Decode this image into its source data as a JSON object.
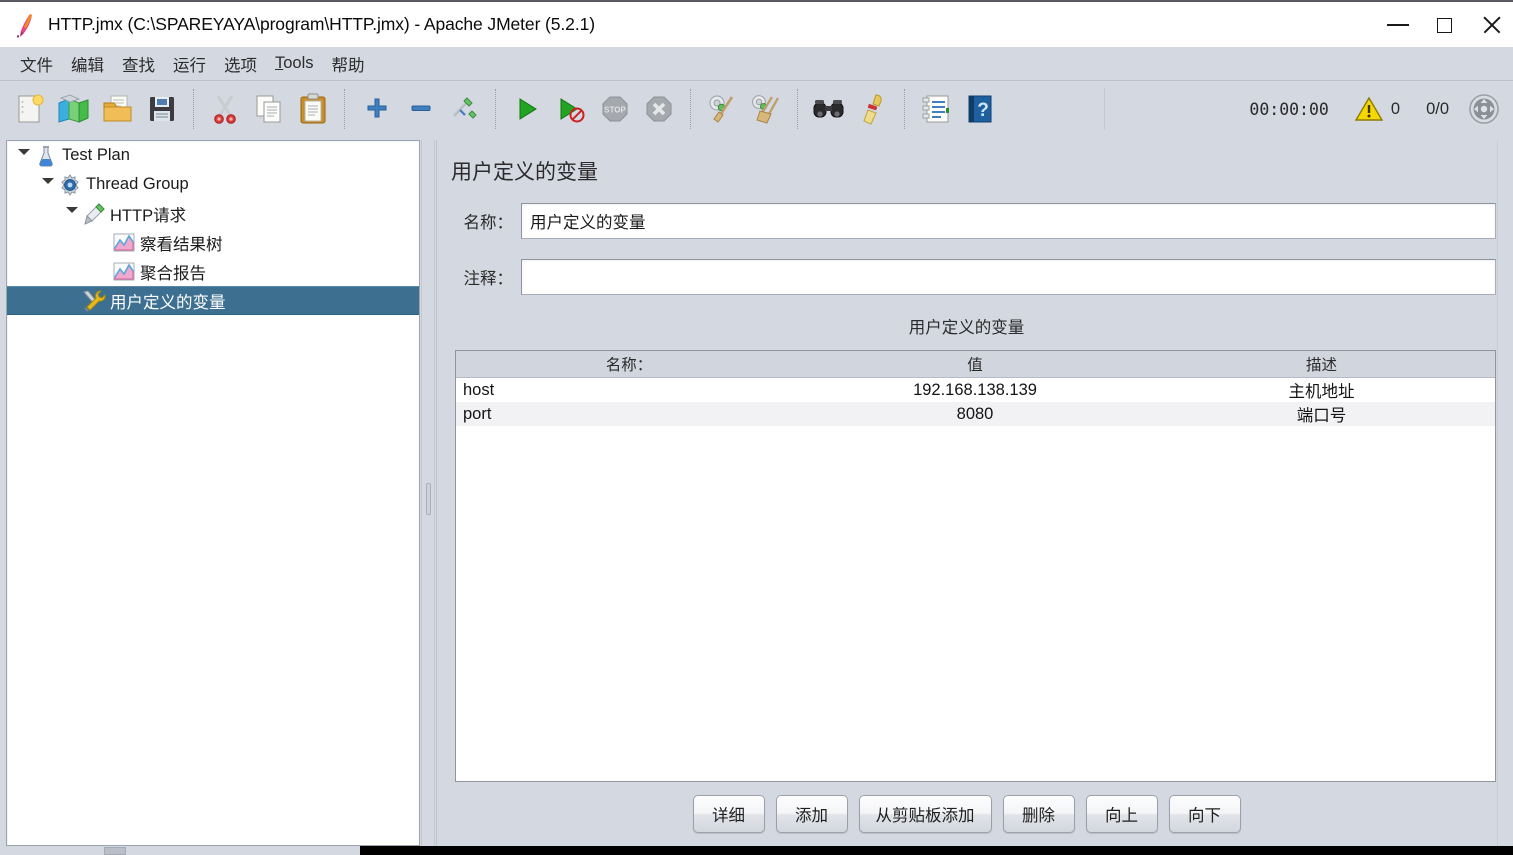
{
  "window": {
    "title": "HTTP.jmx (C:\\SPAREYAYA\\program\\HTTP.jmx) - Apache JMeter (5.2.1)",
    "app_icon": "jmeter-feather-icon",
    "controls": {
      "minimize": "minimize-icon",
      "maximize": "maximize-icon",
      "close": "close-icon"
    }
  },
  "menubar": {
    "items": [
      {
        "label": "文件"
      },
      {
        "label": "编辑"
      },
      {
        "label": "查找"
      },
      {
        "label": "运行"
      },
      {
        "label": "选项"
      },
      {
        "label": "Tools",
        "mnemonic": "T"
      },
      {
        "label": "帮助"
      }
    ]
  },
  "toolbar": {
    "groups": [
      [
        "new-icon",
        "templates-icon",
        "open-icon",
        "save-icon"
      ],
      [
        "cut-icon",
        "copy-icon",
        "paste-icon"
      ],
      [
        "expand-all-icon",
        "collapse-all-icon",
        "toggle-icon"
      ],
      [
        "start-icon",
        "start-no-timers-icon",
        "stop-icon",
        "shutdown-icon"
      ],
      [
        "clear-icon",
        "clear-all-icon"
      ],
      [
        "search-icon",
        "reset-search-icon"
      ],
      [
        "function-helper-icon",
        "help-icon"
      ]
    ],
    "status": {
      "timer": "00:00:00",
      "warning_icon": "warning-triangle-icon",
      "warning_count": "0",
      "thread_count": "0/0",
      "remote_icon": "remote-engines-icon"
    }
  },
  "tree": {
    "items": [
      {
        "label": "Test Plan",
        "icon": "test-plan-icon",
        "indent": 0,
        "expanded": true,
        "selected": false
      },
      {
        "label": "Thread Group",
        "icon": "thread-group-icon",
        "indent": 1,
        "expanded": true,
        "selected": false
      },
      {
        "label": "HTTP请求",
        "icon": "http-request-icon",
        "indent": 2,
        "expanded": true,
        "selected": false
      },
      {
        "label": "察看结果树",
        "icon": "view-results-tree-icon",
        "indent": 3,
        "expanded": false,
        "selected": false
      },
      {
        "label": "聚合报告",
        "icon": "aggregate-report-icon",
        "indent": 3,
        "expanded": false,
        "selected": false
      },
      {
        "label": "用户定义的变量",
        "icon": "user-defined-variables-icon",
        "indent": 2,
        "expanded": false,
        "selected": true
      }
    ]
  },
  "main": {
    "panel_title": "用户定义的变量",
    "name_label": "名称：",
    "name_value": "用户定义的变量",
    "comment_label": "注释：",
    "comment_value": "",
    "table_caption": "用户定义的变量",
    "table": {
      "columns": [
        "名称：",
        "值",
        "描述"
      ],
      "rows": [
        {
          "name": "host",
          "value": "192.168.138.139",
          "desc": "主机地址"
        },
        {
          "name": "port",
          "value": "8080",
          "desc": "端口号"
        }
      ]
    },
    "buttons": [
      {
        "label": "详细"
      },
      {
        "label": "添加"
      },
      {
        "label": "从剪贴板添加"
      },
      {
        "label": "删除"
      },
      {
        "label": "向上"
      },
      {
        "label": "向下"
      }
    ]
  },
  "colors": {
    "window_bg": "#d4d8e0",
    "selection": "#3d6f91",
    "field_bg": "#ffffff",
    "table_header": "#d1d5dd",
    "row_alt": "#f2f2f4",
    "accent_green": "#2e9b2e",
    "warning_yellow": "#f2d200"
  }
}
